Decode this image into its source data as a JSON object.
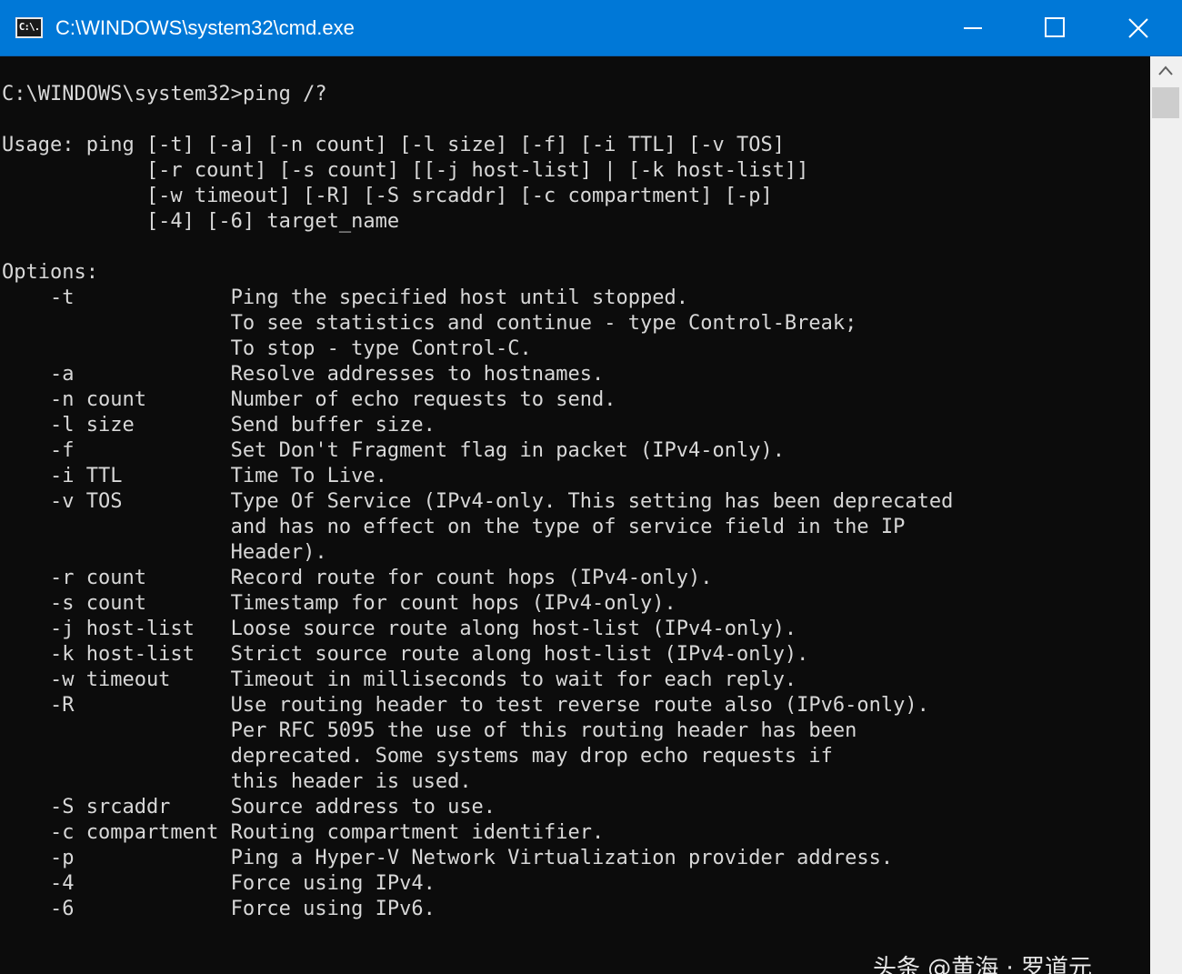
{
  "window": {
    "title": "C:\\WINDOWS\\system32\\cmd.exe",
    "icon_label": "C:\\.",
    "icon": "cmd-app-icon",
    "controls": {
      "minimize_icon": "minimize-icon",
      "maximize_icon": "maximize-icon",
      "close_icon": "close-icon"
    }
  },
  "console": {
    "lines": [
      "C:\\WINDOWS\\system32>ping /?",
      "",
      "Usage: ping [-t] [-a] [-n count] [-l size] [-f] [-i TTL] [-v TOS]",
      "            [-r count] [-s count] [[-j host-list] | [-k host-list]]",
      "            [-w timeout] [-R] [-S srcaddr] [-c compartment] [-p]",
      "            [-4] [-6] target_name",
      "",
      "Options:",
      "    -t             Ping the specified host until stopped.",
      "                   To see statistics and continue - type Control-Break;",
      "                   To stop - type Control-C.",
      "    -a             Resolve addresses to hostnames.",
      "    -n count       Number of echo requests to send.",
      "    -l size        Send buffer size.",
      "    -f             Set Don't Fragment flag in packet (IPv4-only).",
      "    -i TTL         Time To Live.",
      "    -v TOS         Type Of Service (IPv4-only. This setting has been deprecated",
      "                   and has no effect on the type of service field in the IP",
      "                   Header).",
      "    -r count       Record route for count hops (IPv4-only).",
      "    -s count       Timestamp for count hops (IPv4-only).",
      "    -j host-list   Loose source route along host-list (IPv4-only).",
      "    -k host-list   Strict source route along host-list (IPv4-only).",
      "    -w timeout     Timeout in milliseconds to wait for each reply.",
      "    -R             Use routing header to test reverse route also (IPv6-only).",
      "                   Per RFC 5095 the use of this routing header has been",
      "                   deprecated. Some systems may drop echo requests if",
      "                   this header is used.",
      "    -S srcaddr     Source address to use.",
      "    -c compartment Routing compartment identifier.",
      "    -p             Ping a Hyper-V Network Virtualization provider address.",
      "    -4             Force using IPv4.",
      "    -6             Force using IPv6."
    ]
  },
  "scrollbar": {
    "up_icon": "scroll-up-arrow-icon"
  },
  "watermark": {
    "text": "头条 @黄海 · 罗道元"
  },
  "colors": {
    "titlebar": "#0078d7",
    "console_bg": "#0c0c0c",
    "console_fg": "#d8d8d8",
    "scrollbar_track": "#f0f0f0",
    "scrollbar_thumb": "#cdcdcd"
  }
}
